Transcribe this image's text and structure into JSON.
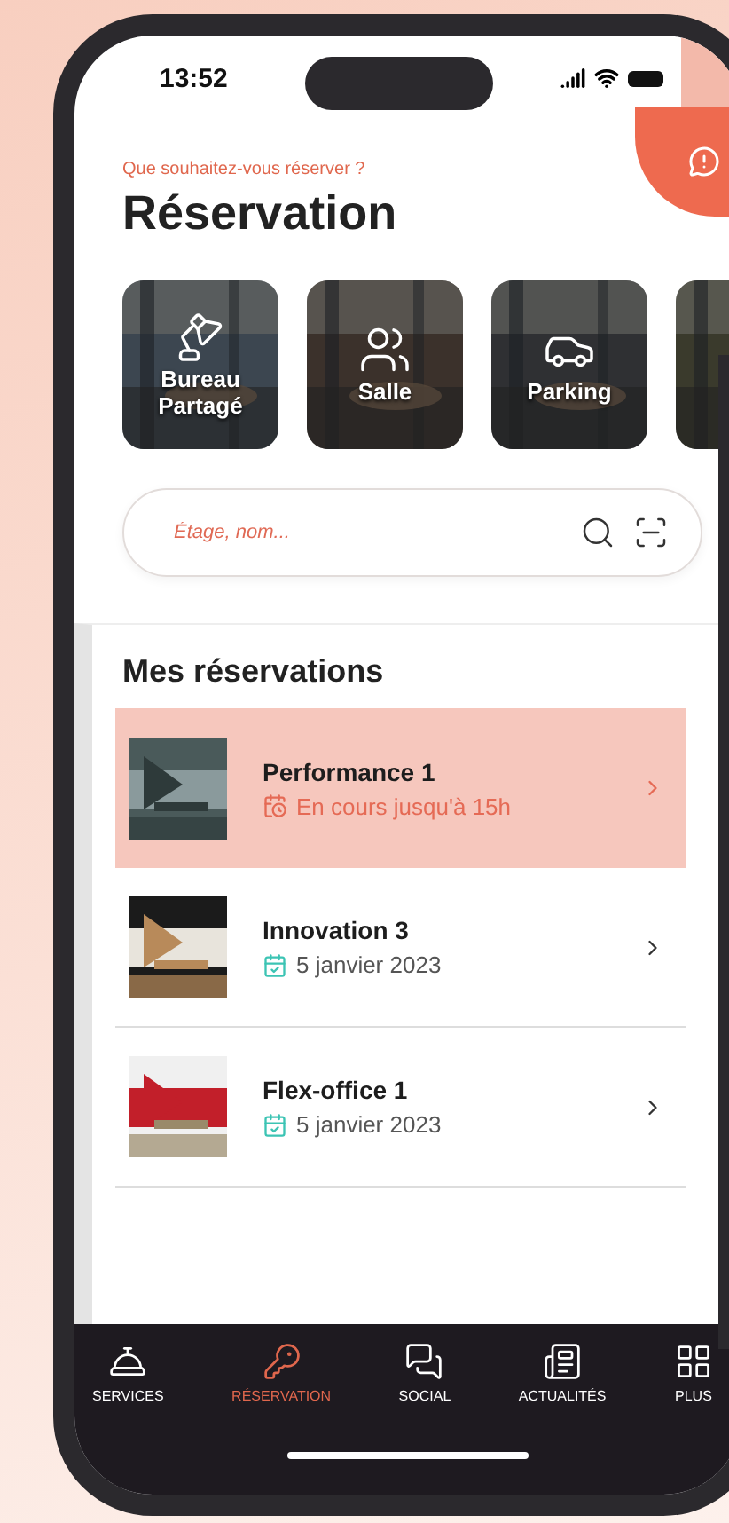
{
  "status_bar": {
    "time": "13:52"
  },
  "header": {
    "subtitle": "Que souhaitez-vous réserver ?",
    "title": "Réservation"
  },
  "categories": [
    {
      "kind": "desk",
      "label": "Bureau Partagé"
    },
    {
      "kind": "room",
      "label": "Salle"
    },
    {
      "kind": "parking",
      "label": "Parking"
    },
    {
      "kind": "picture"
    }
  ],
  "search": {
    "placeholder": "Étage, nom..."
  },
  "reservations": {
    "title": "Mes réservations",
    "items": [
      {
        "name": "Performance 1",
        "date": "En cours jusqu'à 15h",
        "kind": "ongoing",
        "selected": true
      },
      {
        "name": "Innovation 3",
        "date": "5 janvier 2023",
        "kind": "scheduled",
        "selected": false
      },
      {
        "name": "Flex-office 1",
        "date": "5 janvier 2023",
        "kind": "scheduled",
        "selected": false
      }
    ]
  },
  "tabs": [
    {
      "label": "SERVICES",
      "selected": false
    },
    {
      "label": "RÉSERVATION",
      "selected": true
    },
    {
      "label": "SOCIAL",
      "selected": false
    },
    {
      "label": "ACTUALITÉS",
      "selected": false
    },
    {
      "label": "PLUS",
      "selected": false
    }
  ]
}
